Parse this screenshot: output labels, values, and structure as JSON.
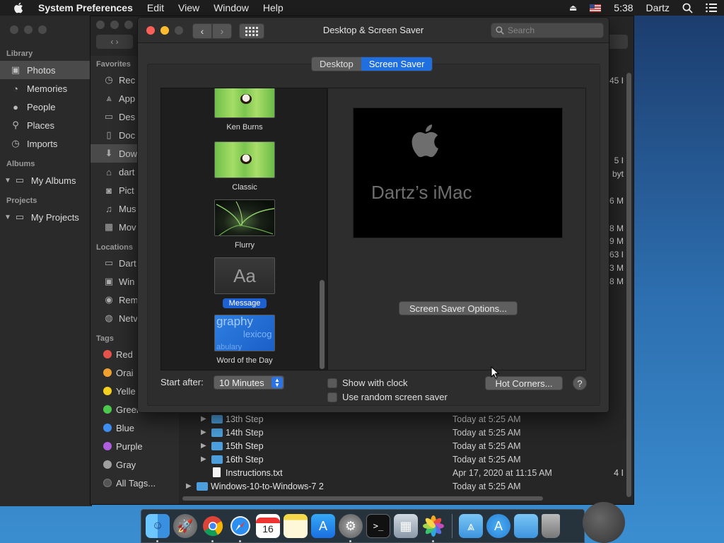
{
  "menubar": {
    "app_name": "System Preferences",
    "items": [
      "Edit",
      "View",
      "Window",
      "Help"
    ],
    "clock": "5:38",
    "user": "Dartz"
  },
  "photos": {
    "library_head": "Library",
    "library_items": [
      "Photos",
      "Memories",
      "People",
      "Places",
      "Imports"
    ],
    "albums_head": "Albums",
    "albums_item": "My Albums",
    "projects_head": "Projects",
    "projects_item": "My Projects"
  },
  "finder": {
    "favorites_head": "Favorites",
    "favorites": [
      "Rec",
      "App",
      "Des",
      "Doc",
      "Dow",
      "dart",
      "Pict",
      "Mus",
      "Mov"
    ],
    "locations_head": "Locations",
    "locations": [
      "Dart",
      "Win",
      "Rem",
      "Netv"
    ],
    "tags_head": "Tags",
    "tags": [
      {
        "name": "Red",
        "color": "#e5534b"
      },
      {
        "name": "Orai",
        "color": "#f0a030"
      },
      {
        "name": "Yelle",
        "color": "#f5d020"
      },
      {
        "name": "Green",
        "color": "#4cc94c"
      },
      {
        "name": "Blue",
        "color": "#3d8ef0"
      },
      {
        "name": "Purple",
        "color": "#b05de0"
      },
      {
        "name": "Gray",
        "color": "#a0a0a0"
      }
    ],
    "all_tags": "All Tags...",
    "right_col": [
      "45 I",
      "5 I",
      "byt",
      ".6 M",
      ".8 M",
      ".9 M",
      "63 I",
      ".3 M",
      ".8 M"
    ],
    "rows": [
      {
        "name": "13th Step",
        "date": "Today at 5:25 AM",
        "size": "",
        "type": "folder"
      },
      {
        "name": "14th Step",
        "date": "Today at 5:25 AM",
        "size": "",
        "type": "folder"
      },
      {
        "name": "15th Step",
        "date": "Today at 5:25 AM",
        "size": "",
        "type": "folder"
      },
      {
        "name": "16th Step",
        "date": "Today at 5:25 AM",
        "size": "",
        "type": "folder"
      },
      {
        "name": "Instructions.txt",
        "date": "Apr 17, 2020 at 11:15 AM",
        "size": "4 I",
        "type": "file"
      },
      {
        "name": "Windows-10-to-Windows-7 2",
        "date": "Today at 5:25 AM",
        "size": "",
        "type": "folder"
      }
    ]
  },
  "dss": {
    "title": "Desktop & Screen Saver",
    "search_placeholder": "Search",
    "tab_desktop": "Desktop",
    "tab_screensaver": "Screen Saver",
    "savers": [
      "Ken Burns",
      "Classic",
      "Flurry",
      "Message",
      "Word of the Day"
    ],
    "selected_saver": "Message",
    "message_thumb_text": "Aa",
    "wod_thumb_lines": [
      "graphy",
      "lexicog",
      "abulary"
    ],
    "preview_text": "Dartz’s iMac",
    "options_button": "Screen Saver Options...",
    "start_after_label": "Start after:",
    "start_after_value": "10 Minutes",
    "show_clock_label": "Show with clock",
    "random_label": "Use random screen saver",
    "hot_corners_button": "Hot Corners...",
    "help_label": "?"
  },
  "dock": {
    "icons": [
      "finder-icon",
      "launchpad-icon",
      "chrome-icon",
      "safari-icon",
      "calendar-icon",
      "notes-icon",
      "app-store-icon",
      "system-preferences-icon",
      "terminal-icon",
      "preview-icon",
      "photos-icon",
      "applications-folder-icon",
      "app-store-folder-icon",
      "documents-folder-icon",
      "trash-icon"
    ],
    "calendar_day": "16"
  }
}
